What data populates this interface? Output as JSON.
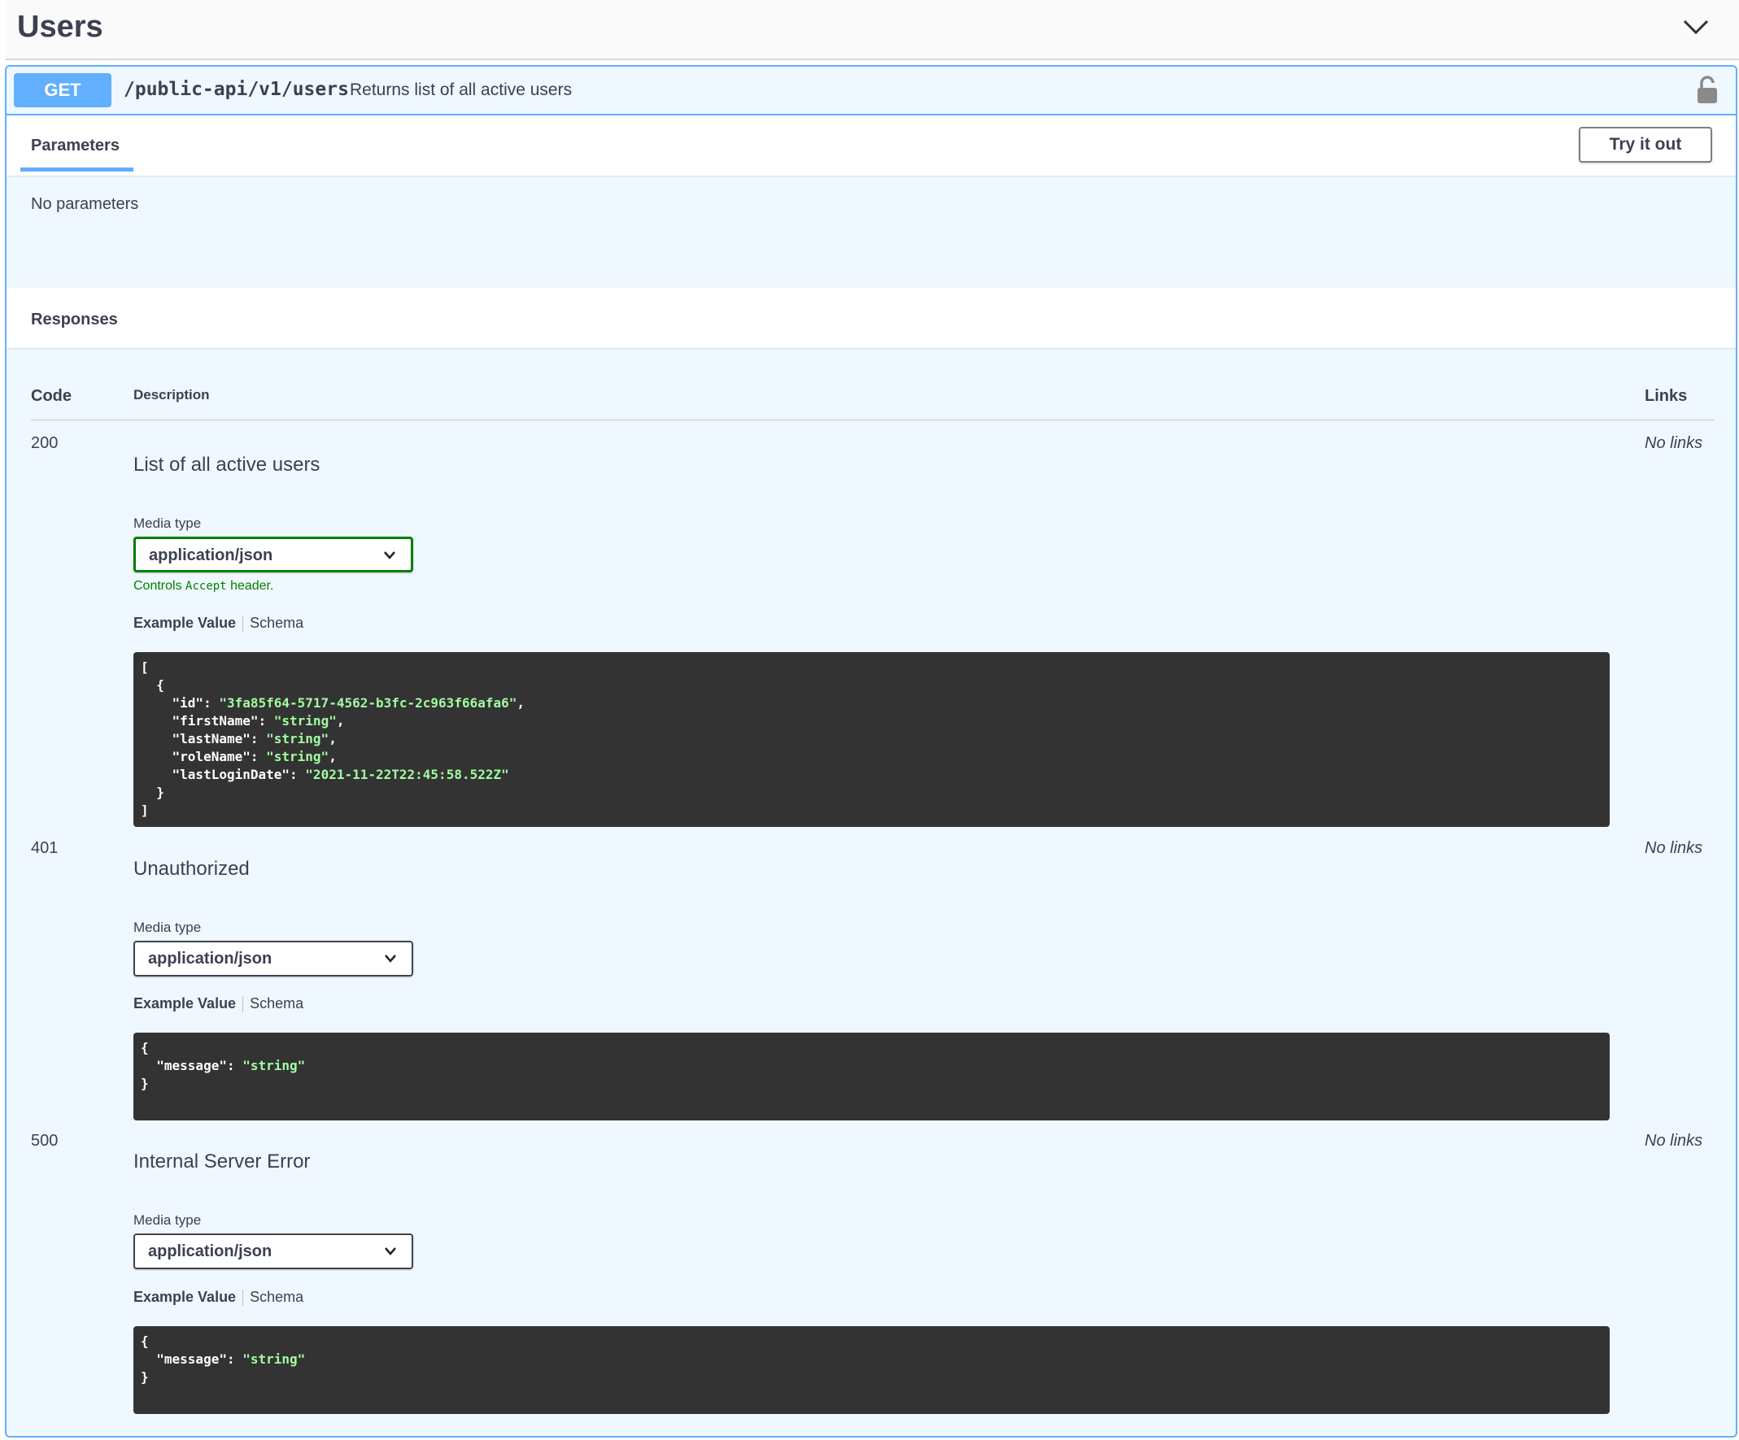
{
  "tag": {
    "title": "Users"
  },
  "operation": {
    "method": "GET",
    "path": "/public-api/v1/users",
    "summary": "Returns list of all active users"
  },
  "parameters": {
    "tab_label": "Parameters",
    "try_label": "Try it out",
    "empty_text": "No parameters"
  },
  "responses": {
    "title": "Responses",
    "columns": {
      "code": "Code",
      "description": "Description",
      "links": "Links"
    },
    "media_type_label": "Media type",
    "controls_note_prefix": "Controls",
    "controls_note_code": "Accept",
    "controls_note_suffix": "header.",
    "example_tab": "Example Value",
    "schema_tab": "Schema",
    "items": [
      {
        "code": "200",
        "description": "List of all active users",
        "links": "No links",
        "media_type": "application/json",
        "example_lines": [
          [
            "[",
            ""
          ],
          [
            "  {",
            ""
          ],
          [
            "    \"id\": ",
            "\"3fa85f64-5717-4562-b3fc-2c963f66afa6\"",
            ","
          ],
          [
            "    \"firstName\": ",
            "\"string\"",
            ","
          ],
          [
            "    \"lastName\": ",
            "\"string\"",
            ","
          ],
          [
            "    \"roleName\": ",
            "\"string\"",
            ","
          ],
          [
            "    \"lastLoginDate\": ",
            "\"2021-11-22T22:45:58.522Z\"",
            ""
          ],
          [
            "  }",
            ""
          ],
          [
            "]",
            ""
          ]
        ]
      },
      {
        "code": "401",
        "description": "Unauthorized",
        "links": "No links",
        "media_type": "application/json",
        "example_lines": [
          [
            "{",
            ""
          ],
          [
            "  \"message\": ",
            "\"string\"",
            ""
          ],
          [
            "}",
            ""
          ]
        ]
      },
      {
        "code": "500",
        "description": "Internal Server Error",
        "links": "No links",
        "media_type": "application/json",
        "example_lines": [
          [
            "{",
            ""
          ],
          [
            "  \"message\": ",
            "\"string\"",
            ""
          ],
          [
            "}",
            ""
          ]
        ]
      }
    ]
  },
  "colors": {
    "get_blue": "#61affe",
    "accent_green": "#008000",
    "code_bg": "#333333",
    "string_green": "#a2fca2"
  },
  "icons": {
    "collapse": "chevron-down-icon",
    "lock": "lock-open-icon",
    "select": "chevron-down-icon"
  }
}
